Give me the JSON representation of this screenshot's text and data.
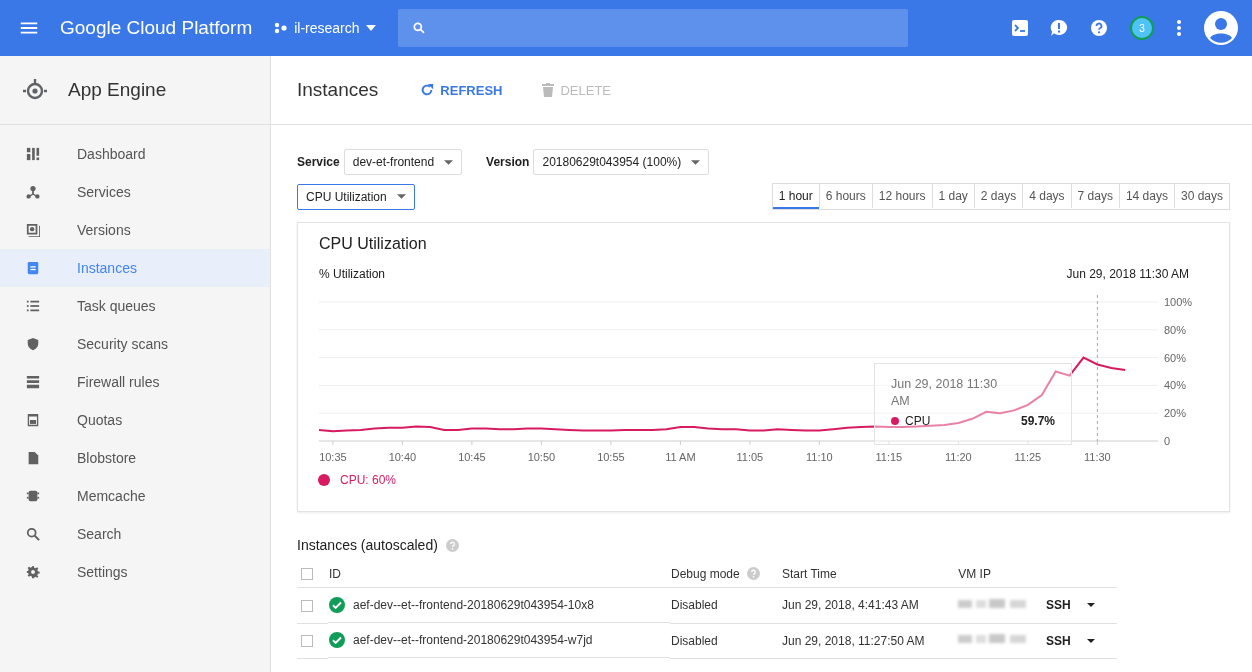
{
  "topbar": {
    "title": "Google Cloud Platform",
    "project": "il-research",
    "notifications": "3"
  },
  "sidebar": {
    "title": "App Engine",
    "items": [
      {
        "label": "Dashboard",
        "selected": false
      },
      {
        "label": "Services",
        "selected": false
      },
      {
        "label": "Versions",
        "selected": false
      },
      {
        "label": "Instances",
        "selected": true
      },
      {
        "label": "Task queues",
        "selected": false
      },
      {
        "label": "Security scans",
        "selected": false
      },
      {
        "label": "Firewall rules",
        "selected": false
      },
      {
        "label": "Quotas",
        "selected": false
      },
      {
        "label": "Blobstore",
        "selected": false
      },
      {
        "label": "Memcache",
        "selected": false
      },
      {
        "label": "Search",
        "selected": false
      },
      {
        "label": "Settings",
        "selected": false
      }
    ]
  },
  "toolbar": {
    "title": "Instances",
    "buttons": [
      {
        "label": "REFRESH",
        "disabled": false
      },
      {
        "label": "DELETE",
        "disabled": true
      }
    ]
  },
  "filters": {
    "service_label": "Service",
    "service": "dev-et-frontend",
    "version_label": "Version",
    "version": "20180629t043954 (100%)",
    "metric": "CPU Utilization"
  },
  "ranges": [
    {
      "label": "1 hour",
      "selected": true
    },
    {
      "label": "6 hours",
      "selected": false
    },
    {
      "label": "12 hours",
      "selected": false
    },
    {
      "label": "1 day",
      "selected": false
    },
    {
      "label": "2 days",
      "selected": false
    },
    {
      "label": "4 days",
      "selected": false
    },
    {
      "label": "7 days",
      "selected": false
    },
    {
      "label": "14 days",
      "selected": false
    },
    {
      "label": "30 days",
      "selected": false
    }
  ],
  "chart": {
    "title": "CPU Utilization",
    "subtitle": "% Utilization",
    "timestamp": "Jun 29, 2018 11:30 AM",
    "tooltip": {
      "time": "Jun 29, 2018 11:30 AM",
      "value": "59.7%"
    },
    "legend": "CPU: 60%",
    "chart_data": {
      "type": "line",
      "categories": [
        null,
        "10:35",
        null,
        null,
        null,
        null,
        "10:40",
        null,
        null,
        null,
        null,
        "10:45",
        null,
        null,
        null,
        null,
        "10:50",
        null,
        null,
        null,
        null,
        "10:55",
        null,
        null,
        null,
        null,
        "11 AM",
        null,
        null,
        null,
        null,
        "11:05",
        null,
        null,
        null,
        null,
        "11:10",
        null,
        null,
        null,
        null,
        "11:15",
        null,
        null,
        null,
        null,
        "11:20",
        null,
        null,
        null,
        null,
        "11:25",
        null,
        null,
        null,
        null,
        "11:30",
        null,
        null
      ],
      "series": [
        {
          "name": "CPU",
          "color": "#d81b60",
          "values": [
            8,
            7,
            7.5,
            8,
            9,
            9.5,
            9.5,
            10.5,
            10,
            8,
            8,
            9,
            9,
            8.5,
            8.5,
            9,
            9,
            8.5,
            8,
            7.5,
            7.5,
            7.5,
            8,
            8,
            8,
            8.5,
            10,
            10,
            9,
            8.5,
            8.5,
            7.5,
            7.5,
            8.5,
            8,
            7.5,
            7.5,
            8.5,
            9.5,
            10,
            10.5,
            10,
            10,
            10.5,
            11,
            11.5,
            13,
            16,
            21,
            20,
            22,
            26,
            33,
            50,
            47,
            60,
            55,
            52.5,
            51
          ]
        }
      ],
      "grid": true,
      "ylim": [
        0,
        100
      ],
      "yticks": [
        {
          "value": 0,
          "label": "0"
        },
        {
          "value": 20,
          "label": "20%"
        },
        {
          "value": 40,
          "label": "40%"
        },
        {
          "value": 60,
          "label": "60%"
        },
        {
          "value": 80,
          "label": "80%"
        },
        {
          "value": 100,
          "label": "100%"
        }
      ]
    }
  },
  "instances": {
    "title": "Instances (autoscaled)",
    "select_all_checked": false,
    "columns": [
      "ID",
      "Debug mode",
      "Start Time",
      "VM IP"
    ],
    "rows": [
      {
        "id": "aef-dev--et--frontend-20180629t043954-10x8",
        "debug": "Disabled",
        "start": "Jun 29, 2018, 4:41:43 AM",
        "action": "SSH",
        "checked": false
      },
      {
        "id": "aef-dev--et--frontend-20180629t043954-w7jd",
        "debug": "Disabled",
        "start": "Jun 29, 2018, 11:27:50 AM",
        "action": "SSH",
        "checked": false
      }
    ]
  }
}
